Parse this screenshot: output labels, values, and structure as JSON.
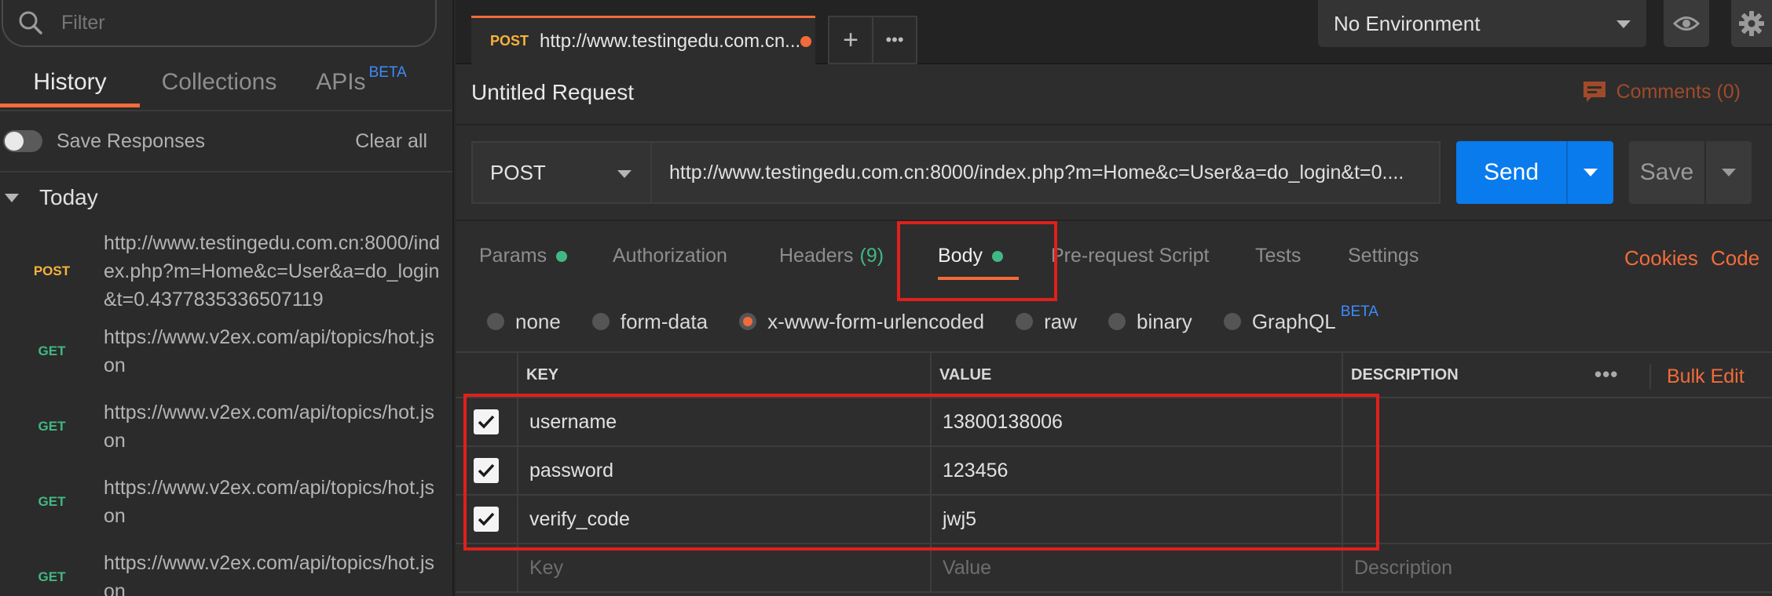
{
  "sidebar": {
    "filter_placeholder": "Filter",
    "tabs": [
      {
        "label": "History",
        "active": true
      },
      {
        "label": "Collections"
      },
      {
        "label": "APIs",
        "badge": "BETA"
      }
    ],
    "save_responses_label": "Save Responses",
    "clear_all_label": "Clear all",
    "group_label": "Today",
    "history": [
      {
        "method": "POST",
        "url": "http://www.testingedu.com.cn:8000/index.php?m=Home&c=User&a=do_login&t=0.4377835336507119"
      },
      {
        "method": "GET",
        "url": "https://www.v2ex.com/api/topics/hot.json"
      },
      {
        "method": "GET",
        "url": "https://www.v2ex.com/api/topics/hot.json"
      },
      {
        "method": "GET",
        "url": "https://www.v2ex.com/api/topics/hot.json"
      },
      {
        "method": "GET",
        "url": "https://www.v2ex.com/api/topics/hot.json"
      }
    ]
  },
  "topbar": {
    "tab_method": "POST",
    "tab_url": "http://www.testingedu.com.cn...",
    "add_tab": "+",
    "more_tabs": "•••",
    "environment": "No Environment"
  },
  "request": {
    "title": "Untitled Request",
    "comments_label": "Comments (0)",
    "method": "POST",
    "url": "http://www.testingedu.com.cn:8000/index.php?m=Home&c=User&a=do_login&t=0....",
    "send_label": "Send",
    "save_label": "Save"
  },
  "request_tabs": {
    "params": "Params",
    "authorization": "Authorization",
    "headers": "Headers",
    "headers_count": "(9)",
    "body": "Body",
    "prerequest": "Pre-request Script",
    "tests": "Tests",
    "settings": "Settings",
    "cookies": "Cookies",
    "code": "Code"
  },
  "body_types": {
    "none": "none",
    "form_data": "form-data",
    "urlencoded": "x-www-form-urlencoded",
    "raw": "raw",
    "binary": "binary",
    "graphql": "GraphQL",
    "graphql_badge": "BETA",
    "selected": "x-www-form-urlencoded"
  },
  "table": {
    "headers": {
      "key": "KEY",
      "value": "VALUE",
      "description": "DESCRIPTION",
      "more": "•••",
      "bulk_edit": "Bulk Edit"
    },
    "rows": [
      {
        "key": "username",
        "value": "13800138006",
        "description": "",
        "checked": true
      },
      {
        "key": "password",
        "value": "123456",
        "description": "",
        "checked": true
      },
      {
        "key": "verify_code",
        "value": "jwj5",
        "description": "",
        "checked": true
      }
    ],
    "placeholders": {
      "key": "Key",
      "value": "Value",
      "description": "Description"
    }
  },
  "colors": {
    "accent": "#f26b3a",
    "send_blue": "#097bed",
    "post_method": "#f6b33c",
    "get_method": "#41b883",
    "annotation_red": "#e0201c"
  }
}
